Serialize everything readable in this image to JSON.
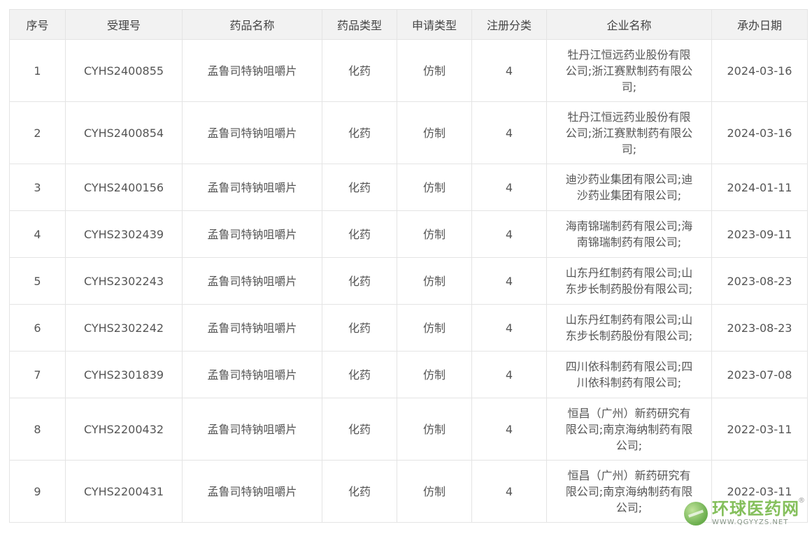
{
  "table": {
    "headers": [
      "序号",
      "受理号",
      "药品名称",
      "药品类型",
      "申请类型",
      "注册分类",
      "企业名称",
      "承办日期"
    ],
    "rows": [
      [
        "1",
        "CYHS2400855",
        "孟鲁司特钠咀嚼片",
        "化药",
        "仿制",
        "4",
        "牡丹江恒远药业股份有限公司;浙江赛默制药有限公司;",
        "2024-03-16"
      ],
      [
        "2",
        "CYHS2400854",
        "孟鲁司特钠咀嚼片",
        "化药",
        "仿制",
        "4",
        "牡丹江恒远药业股份有限公司;浙江赛默制药有限公司;",
        "2024-03-16"
      ],
      [
        "3",
        "CYHS2400156",
        "孟鲁司特钠咀嚼片",
        "化药",
        "仿制",
        "4",
        "迪沙药业集团有限公司;迪沙药业集团有限公司;",
        "2024-01-11"
      ],
      [
        "4",
        "CYHS2302439",
        "孟鲁司特钠咀嚼片",
        "化药",
        "仿制",
        "4",
        "海南锦瑞制药有限公司;海南锦瑞制药有限公司;",
        "2023-09-11"
      ],
      [
        "5",
        "CYHS2302243",
        "孟鲁司特钠咀嚼片",
        "化药",
        "仿制",
        "4",
        "山东丹红制药有限公司;山东步长制药股份有限公司;",
        "2023-08-23"
      ],
      [
        "6",
        "CYHS2302242",
        "孟鲁司特钠咀嚼片",
        "化药",
        "仿制",
        "4",
        "山东丹红制药有限公司;山东步长制药股份有限公司;",
        "2023-08-23"
      ],
      [
        "7",
        "CYHS2301839",
        "孟鲁司特钠咀嚼片",
        "化药",
        "仿制",
        "4",
        "四川依科制药有限公司;四川依科制药有限公司;",
        "2023-07-08"
      ],
      [
        "8",
        "CYHS2200432",
        "孟鲁司特钠咀嚼片",
        "化药",
        "仿制",
        "4",
        "恒昌（广州）新药研究有限公司;南京海纳制药有限公司;",
        "2022-03-11"
      ],
      [
        "9",
        "CYHS2200431",
        "孟鲁司特钠咀嚼片",
        "化药",
        "仿制",
        "4",
        "恒昌（广州）新药研究有限公司;南京海纳制药有限公司;",
        "2022-03-11"
      ]
    ]
  },
  "watermark": {
    "name_cn": "环球医药网",
    "site": "WWW.QGYYZS.NET",
    "registered": "®",
    "icon": "globe-logo-icon",
    "accent": "#77b94a"
  }
}
